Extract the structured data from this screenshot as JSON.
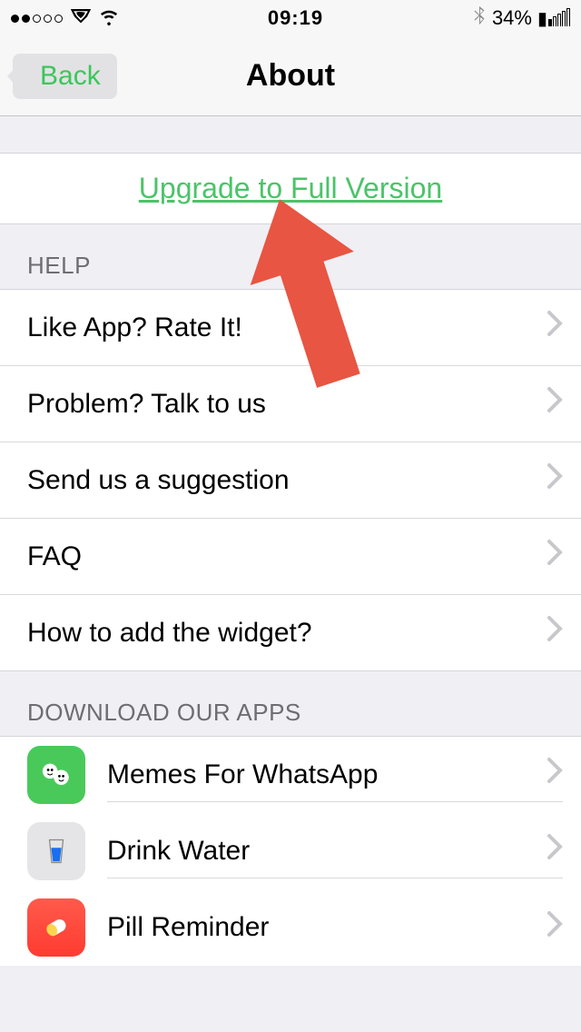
{
  "status": {
    "time": "09:19",
    "battery_pct": "34%"
  },
  "nav": {
    "back_label": "Back",
    "title": "About"
  },
  "upgrade": {
    "text": "Upgrade to Full Version"
  },
  "help": {
    "header": "HELP",
    "items": [
      {
        "label": "Like App? Rate It!"
      },
      {
        "label": "Problem? Talk to us"
      },
      {
        "label": "Send us a suggestion"
      },
      {
        "label": "FAQ"
      },
      {
        "label": "How to add the widget?"
      }
    ]
  },
  "apps": {
    "header": "DOWNLOAD OUR APPS",
    "items": [
      {
        "label": "Memes For WhatsApp",
        "icon": "memes-icon"
      },
      {
        "label": "Drink Water",
        "icon": "water-icon"
      },
      {
        "label": "Pill Reminder",
        "icon": "pill-icon"
      }
    ]
  }
}
